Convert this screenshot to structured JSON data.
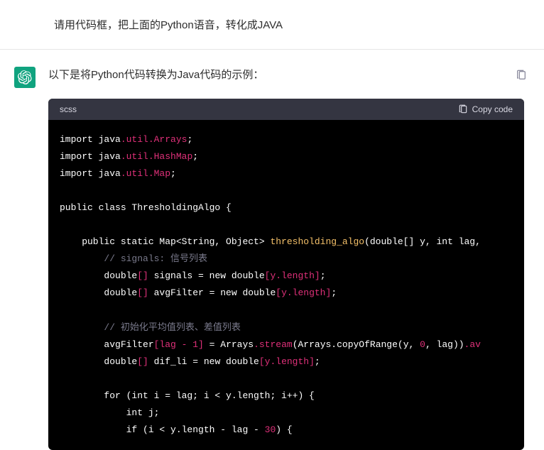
{
  "user": {
    "message": "请用代码框，把上面的Python语音，转化成JAVA"
  },
  "assistant": {
    "intro": "以下是将Python代码转换为Java代码的示例：",
    "code_lang": "scss",
    "copy_label": "Copy code",
    "code": {
      "l1_import": "import",
      "l1_java": " java",
      "l1_pkg": ".util.Arrays",
      "l1_semi": ";",
      "l2_import": "import",
      "l2_java": " java",
      "l2_pkg": ".util.HashMap",
      "l2_semi": ";",
      "l3_import": "import",
      "l3_java": " java",
      "l3_pkg": ".util.Map",
      "l3_semi": ";",
      "l4_class": "public class ThresholdingAlgo {",
      "l5_pre": "    public static Map<String, Object> ",
      "l5_fn": "thresholding_algo",
      "l5_post": "(double[] y, int lag,",
      "l6_comment": "        // signals: 信号列表",
      "l7_pre": "        double",
      "l7_brkt": "[]",
      "l7_mid": " signals = new double",
      "l7_brkt2a": "[",
      "l7_prop": "y.length",
      "l7_brkt2b": "]",
      "l7_semi": ";",
      "l8_pre": "        double",
      "l8_brkt": "[]",
      "l8_mid": " avgFilter = new double",
      "l8_brkt2a": "[",
      "l8_prop": "y.length",
      "l8_brkt2b": "]",
      "l8_semi": ";",
      "l9_comment": "        // 初始化平均值列表、差值列表",
      "l10_pre": "        avgFilter",
      "l10_brkt1": "[lag - ",
      "l10_num1": "1",
      "l10_brkt1b": "]",
      "l10_mid": " = Arrays",
      "l10_method": ".stream",
      "l10_post1": "(Arrays.copyOfRange(y, ",
      "l10_num2": "0",
      "l10_post2": ", lag))",
      "l10_method2": ".av",
      "l11_pre": "        double",
      "l11_brkt": "[]",
      "l11_mid": " dif_li = new double",
      "l11_brkt2a": "[",
      "l11_prop": "y.length",
      "l11_brkt2b": "]",
      "l11_semi": ";",
      "l12_for": "        for (int i = lag; i < y.length; i++) {",
      "l13_intj": "            int j;",
      "l14_pre": "            if (i < y.length - lag - ",
      "l14_num": "30",
      "l14_post": ") {"
    }
  }
}
